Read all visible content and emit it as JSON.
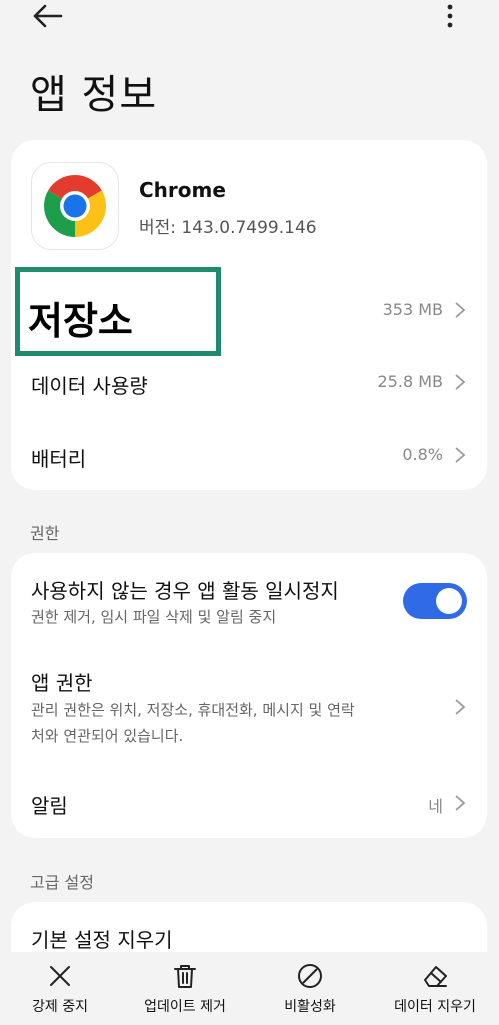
{
  "page": {
    "title": "앱 정보"
  },
  "app": {
    "name": "Chrome",
    "version": "버전: 143.0.7499.146"
  },
  "rows": {
    "storage": {
      "title": "저장소",
      "value": "353 MB"
    },
    "data_usage": {
      "title": "데이터 사용량",
      "value": "25.8 MB"
    },
    "battery": {
      "title": "배터리",
      "value": "0.8%"
    }
  },
  "permissions_section": {
    "label": "권한",
    "pause": {
      "title": "사용하지 않는 경우 앱 활동 일시정지",
      "subtitle": "권한 제거, 임시 파일 삭제 및 알림 중지",
      "enabled": true
    },
    "app_permissions": {
      "title": "앱 권한",
      "subtitle_line1": "관리 권한은 위치, 저장소, 휴대전화, 메시지 및 연락",
      "subtitle_line2": "처와 연관되어 있습니다."
    },
    "notifications": {
      "title": "알림",
      "value": "네"
    }
  },
  "advanced_section": {
    "label": "고급 설정",
    "clear_defaults": {
      "title": "기본 설정 지우기"
    }
  },
  "bottom_bar": {
    "force_stop": "강제 중지",
    "uninstall_updates": "업데이트 제거",
    "disable": "비활성화",
    "clear_data": "데이터 지우기"
  },
  "colors": {
    "accent": "#2f6be6",
    "highlight": "#1e8a6e"
  },
  "icons": {
    "back": "arrow-left-icon",
    "more": "more-vertical-icon",
    "chevron": "chevron-right-icon",
    "force_stop": "close-icon",
    "uninstall_updates": "trash-icon",
    "disable": "block-icon",
    "clear_data": "eraser-icon"
  }
}
